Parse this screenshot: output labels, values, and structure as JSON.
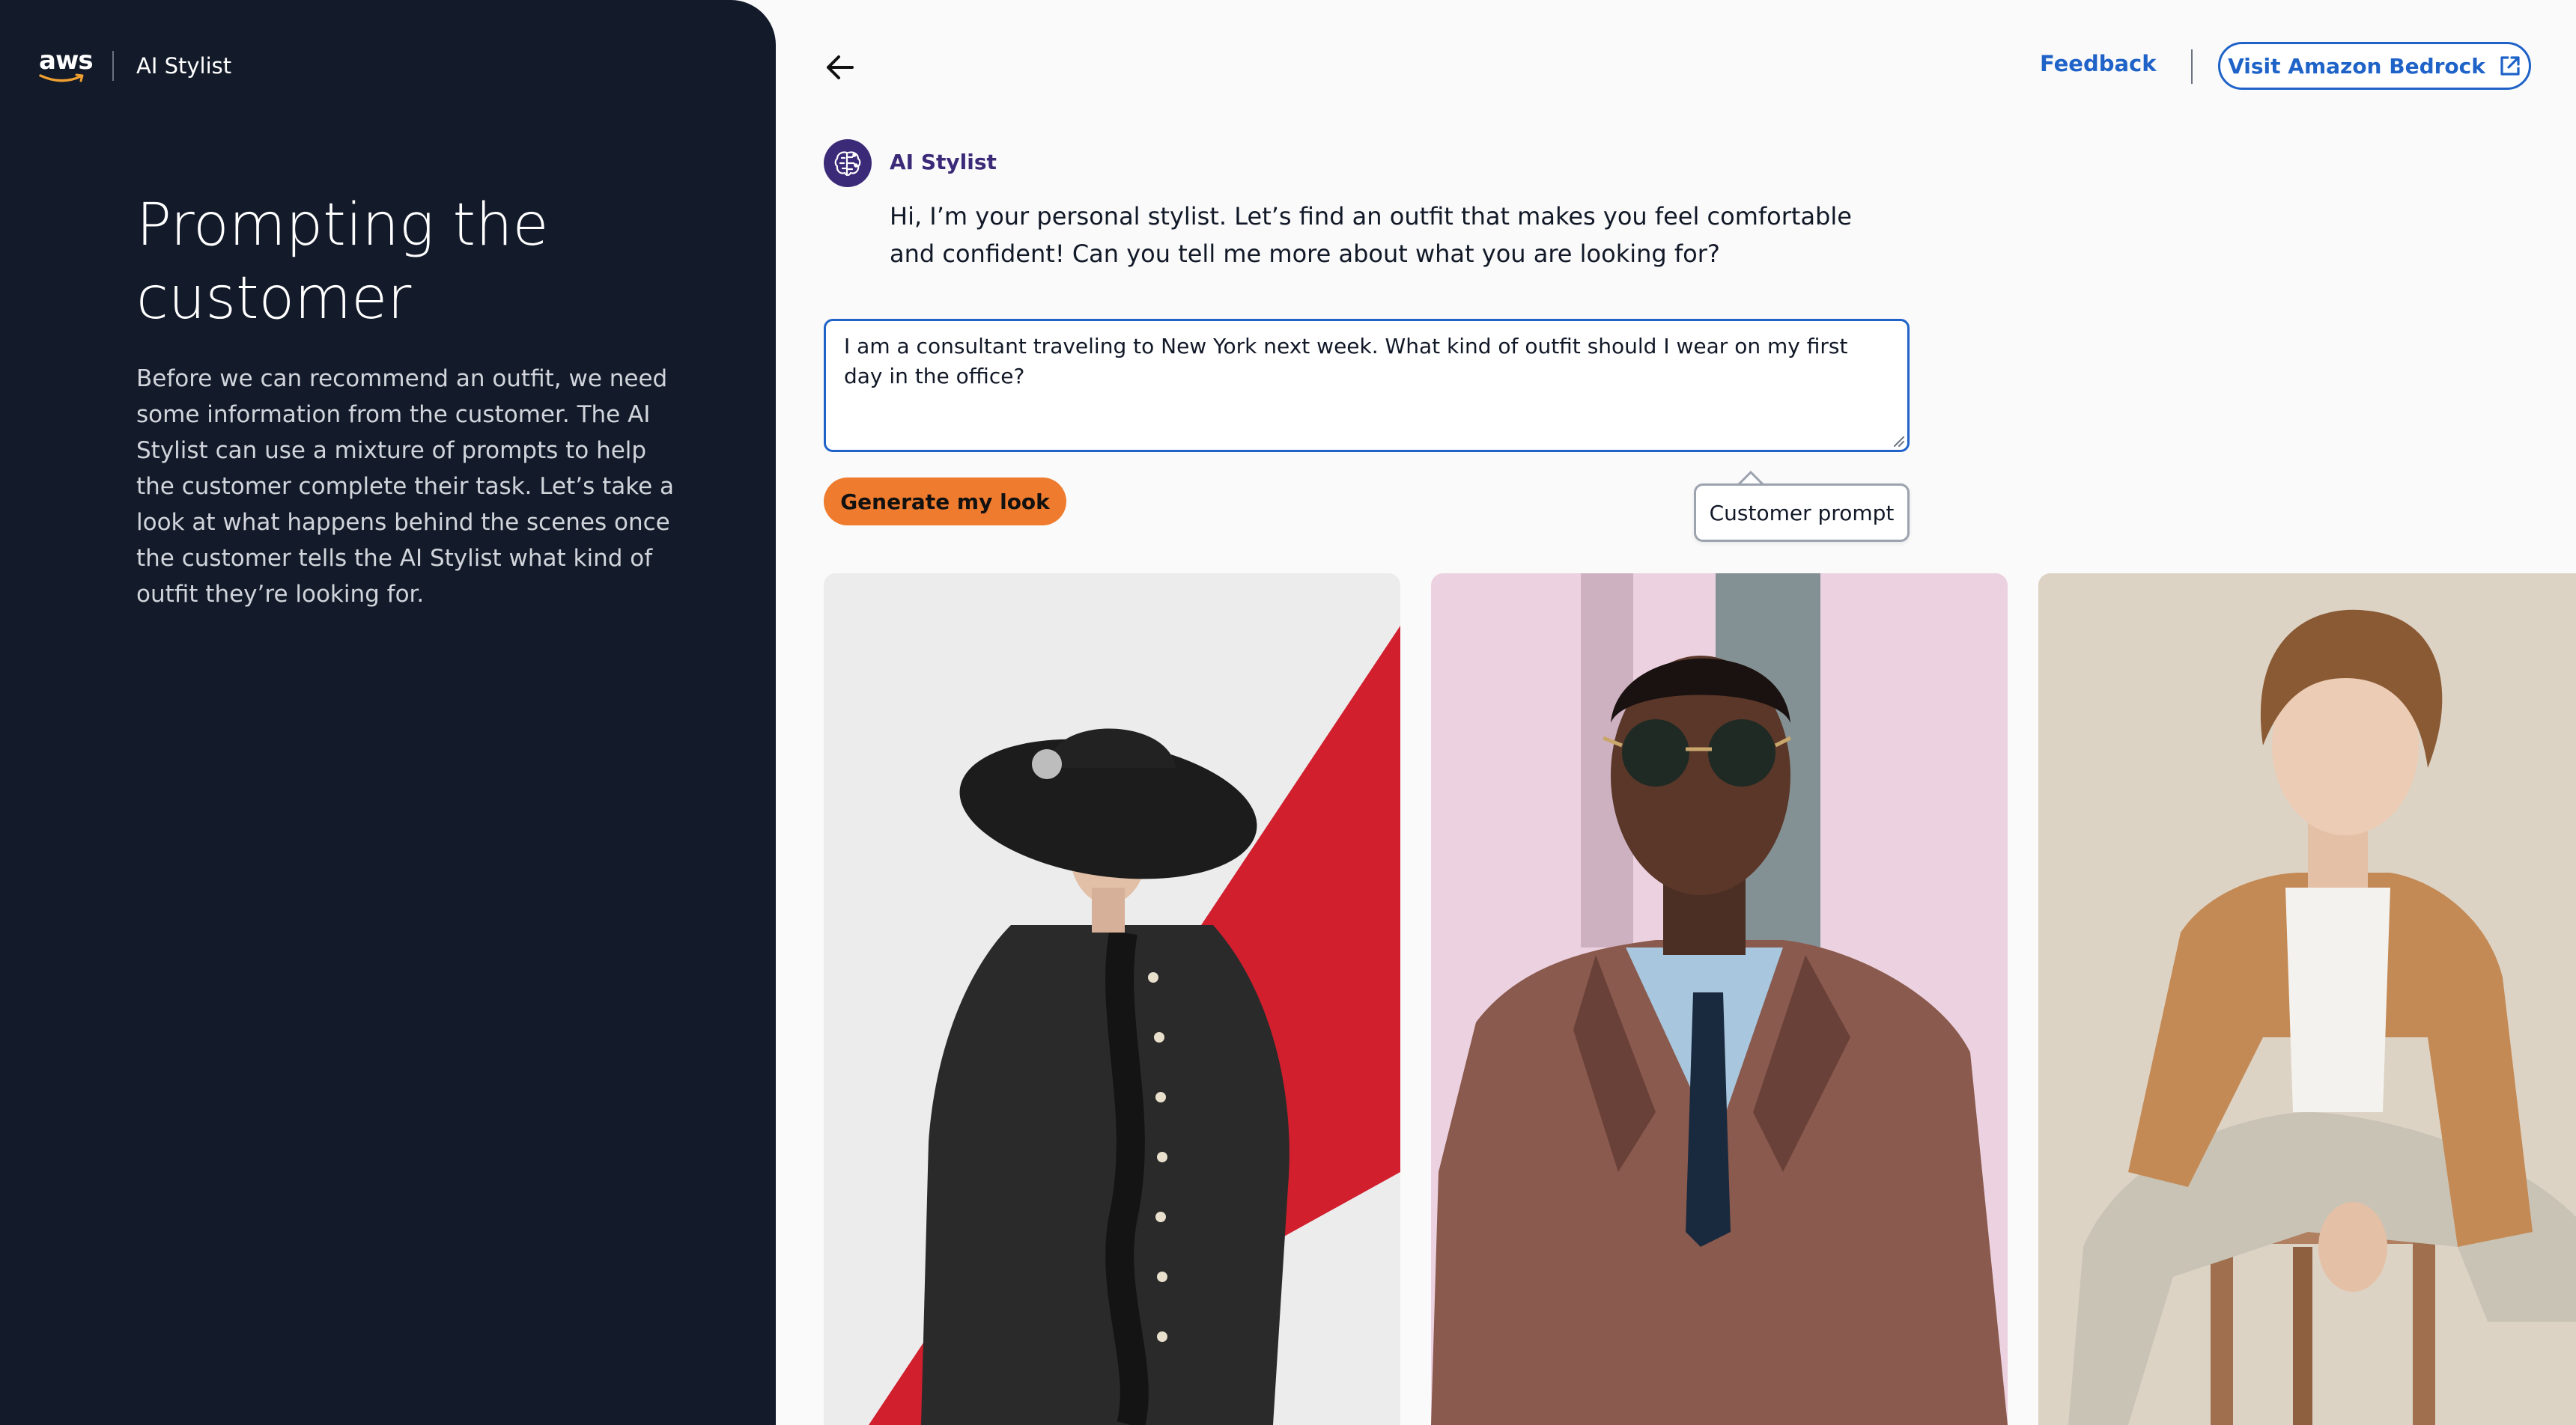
{
  "brand": {
    "logo_text": "aws",
    "app_name": "AI Stylist"
  },
  "left_panel": {
    "title": "Prompting the customer",
    "body": "Before we can recommend an outfit, we need some information from the customer. The AI Stylist can use a mixture of prompts to help the customer complete their task. Let’s take a look at what happens behind the scenes once the customer tells the AI Stylist what kind of outfit they’re looking for."
  },
  "header": {
    "feedback_label": "Feedback",
    "bedrock_label": "Visit Amazon Bedrock"
  },
  "chat": {
    "assistant_name": "AI Stylist",
    "assistant_message": "Hi, I’m your personal stylist. Let’s find an outfit that makes you feel comfortable and confident! Can you tell me more about what you are looking for?"
  },
  "prompt": {
    "value": "I am a consultant traveling to New York next week. What kind of outfit should I wear on my first day in the office?",
    "generate_label": "Generate my look",
    "tooltip": "Customer prompt"
  },
  "icons": {
    "back": "arrow-left-icon",
    "external": "external-link-icon",
    "avatar": "brain-circuit-icon"
  },
  "colors": {
    "panel_bg": "#131a2a",
    "accent_blue": "#1f63c8",
    "accent_orange": "#ee7b2e",
    "assistant_purple": "#3b2a78"
  }
}
